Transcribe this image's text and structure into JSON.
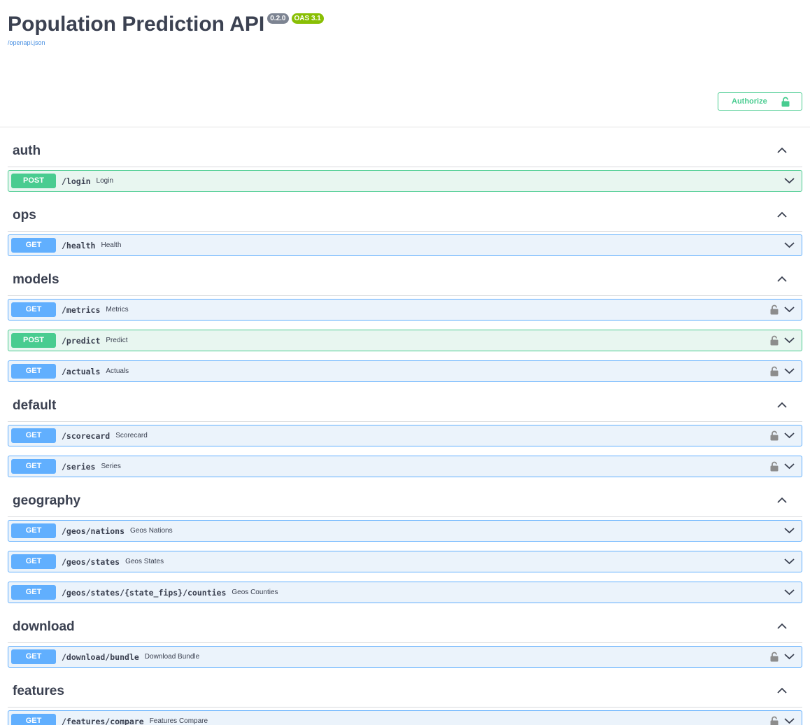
{
  "info": {
    "title": "Population Prediction API",
    "version_badge": "0.2.0",
    "oas_badge": "OAS 3.1",
    "spec_link": "/openapi.json"
  },
  "authorize": {
    "label": "Authorize",
    "icon": "unlocked-lock-icon"
  },
  "colors": {
    "get": "#61affe",
    "get_bg": "#ebf3fb",
    "post": "#49cc90",
    "post_bg": "#e8f6f0",
    "text": "#3b4151",
    "link": "#4990e2",
    "version_badge": "#7d8492",
    "oas_badge": "#89bf04"
  },
  "tags": [
    {
      "name": "auth",
      "operations": [
        {
          "method": "POST",
          "path": "/login",
          "summary": "Login",
          "locked": false
        }
      ]
    },
    {
      "name": "ops",
      "operations": [
        {
          "method": "GET",
          "path": "/health",
          "summary": "Health",
          "locked": false
        }
      ]
    },
    {
      "name": "models",
      "operations": [
        {
          "method": "GET",
          "path": "/metrics",
          "summary": "Metrics",
          "locked": true
        },
        {
          "method": "POST",
          "path": "/predict",
          "summary": "Predict",
          "locked": true
        },
        {
          "method": "GET",
          "path": "/actuals",
          "summary": "Actuals",
          "locked": true
        }
      ]
    },
    {
      "name": "default",
      "operations": [
        {
          "method": "GET",
          "path": "/scorecard",
          "summary": "Scorecard",
          "locked": true
        },
        {
          "method": "GET",
          "path": "/series",
          "summary": "Series",
          "locked": true
        }
      ]
    },
    {
      "name": "geography",
      "operations": [
        {
          "method": "GET",
          "path": "/geos/nations",
          "summary": "Geos Nations",
          "locked": false
        },
        {
          "method": "GET",
          "path": "/geos/states",
          "summary": "Geos States",
          "locked": false
        },
        {
          "method": "GET",
          "path": "/geos/states/{state_fips}/counties",
          "summary": "Geos Counties",
          "locked": false
        }
      ]
    },
    {
      "name": "download",
      "operations": [
        {
          "method": "GET",
          "path": "/download/bundle",
          "summary": "Download Bundle",
          "locked": true
        }
      ]
    },
    {
      "name": "features",
      "operations": [
        {
          "method": "GET",
          "path": "/features/compare",
          "summary": "Features Compare",
          "locked": true
        }
      ]
    }
  ]
}
